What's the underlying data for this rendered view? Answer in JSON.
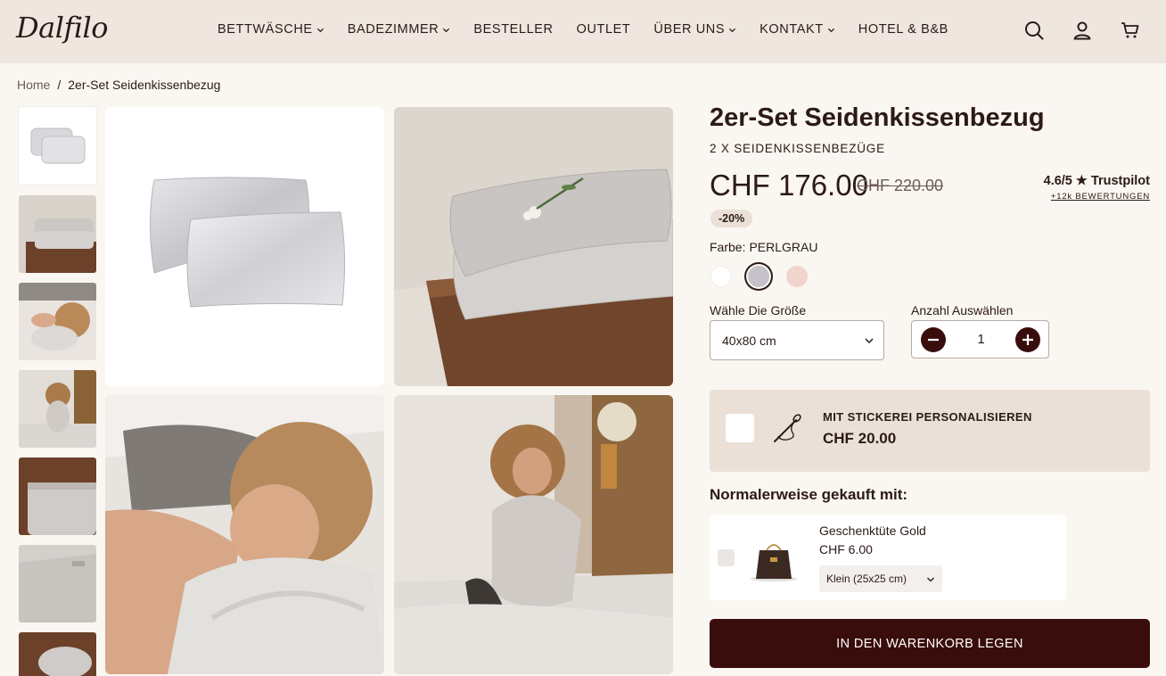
{
  "header": {
    "logo": "Dalfilo",
    "nav": [
      {
        "label": "BETTWÄSCHE",
        "dropdown": true
      },
      {
        "label": "BADEZIMMER",
        "dropdown": true
      },
      {
        "label": "BESTELLER",
        "dropdown": false
      },
      {
        "label": "OUTLET",
        "dropdown": false
      },
      {
        "label": "ÜBER UNS",
        "dropdown": true
      },
      {
        "label": "KONTAKT",
        "dropdown": true
      },
      {
        "label": "HOTEL & B&B",
        "dropdown": false
      }
    ],
    "icons": [
      "search-icon",
      "account-icon",
      "cart-icon"
    ]
  },
  "breadcrumb": {
    "home": "Home",
    "separator": "/",
    "current": "2er-Set Seidenkissenbezug"
  },
  "product": {
    "title": "2er-Set Seidenkissenbezug",
    "subtitle": "2 X SEIDENKISSENBEZÜGE",
    "price": "CHF 176.00",
    "old_price": "CHF 220.00",
    "discount": "-20%",
    "rating": "4.6/5",
    "rating_provider": "Trustpilot",
    "reviews": "+12k BEWERTUNGEN",
    "color_label": "Farbe:",
    "color_value": "PERLGRAU",
    "colors": [
      {
        "name": "white",
        "hex": "#ffffff",
        "selected": false
      },
      {
        "name": "perlgrau",
        "hex": "#c5c3c9",
        "selected": true
      },
      {
        "name": "rose",
        "hex": "#f0d4cd",
        "selected": false
      }
    ],
    "size_label": "Wähle Die Größe",
    "size_value": "40x80 cm",
    "qty_label": "Anzahl Auswählen",
    "qty_value": "1"
  },
  "embroidery": {
    "title": "MIT STICKEREI PERSONALISIEREN",
    "price": "CHF 20.00",
    "checked": false
  },
  "bought_with": {
    "title": "Normalerweise gekauft mit:",
    "item": {
      "name": "Geschenktüte Gold",
      "price": "CHF 6.00",
      "option": "Klein (25x25 cm)",
      "checked": false
    }
  },
  "cart_button": "IN DEN WARENKORB LEGEN",
  "colors": {
    "accent": "#3a0d0d",
    "header_bg": "#efe7df",
    "page_bg": "#faf6f1",
    "text": "#2b1a17"
  }
}
